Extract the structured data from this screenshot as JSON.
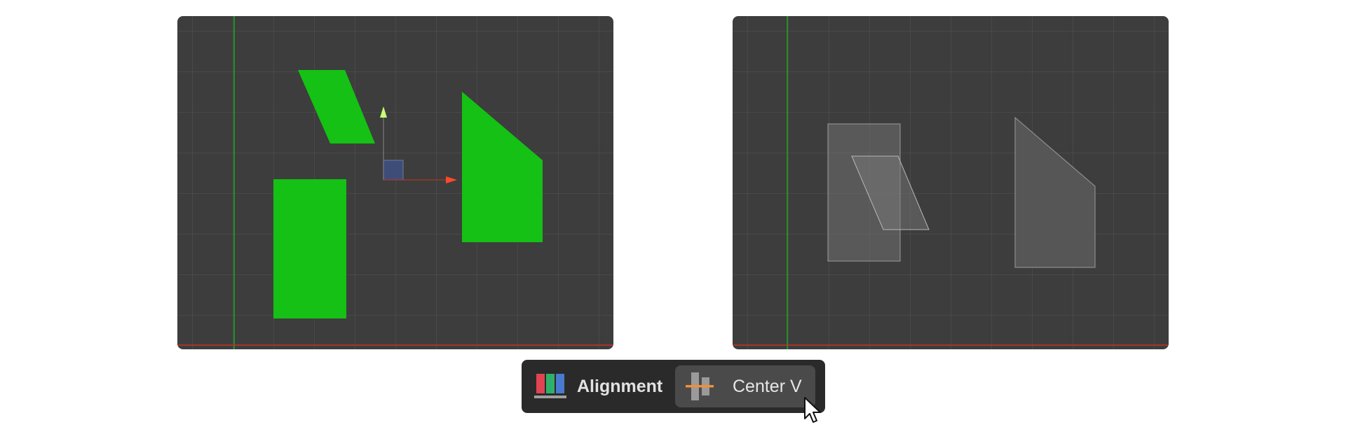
{
  "toolbar": {
    "title": "Alignment",
    "active_tool_label": "Center V",
    "title_icon": "alignment-palette-icon",
    "tool_icon": "align-center-vertical-icon"
  },
  "viewports": {
    "before": {
      "state": "selected",
      "shape_color": "#14c114"
    },
    "after": {
      "state": "aligned",
      "shape_color": "#5a5a5a"
    }
  },
  "colors": {
    "viewport_bg": "#3d3d3d",
    "axis_x": "#c8321e",
    "axis_y": "#1fa81f",
    "gizmo_x": "#ff4a2a",
    "gizmo_y": "#c8ff73",
    "toolbar_bg": "#2a2a2a",
    "button_bg": "#4a4a4a",
    "accent_orange": "#f0903c"
  },
  "cursor": {
    "icon": "mouse-pointer-icon"
  }
}
